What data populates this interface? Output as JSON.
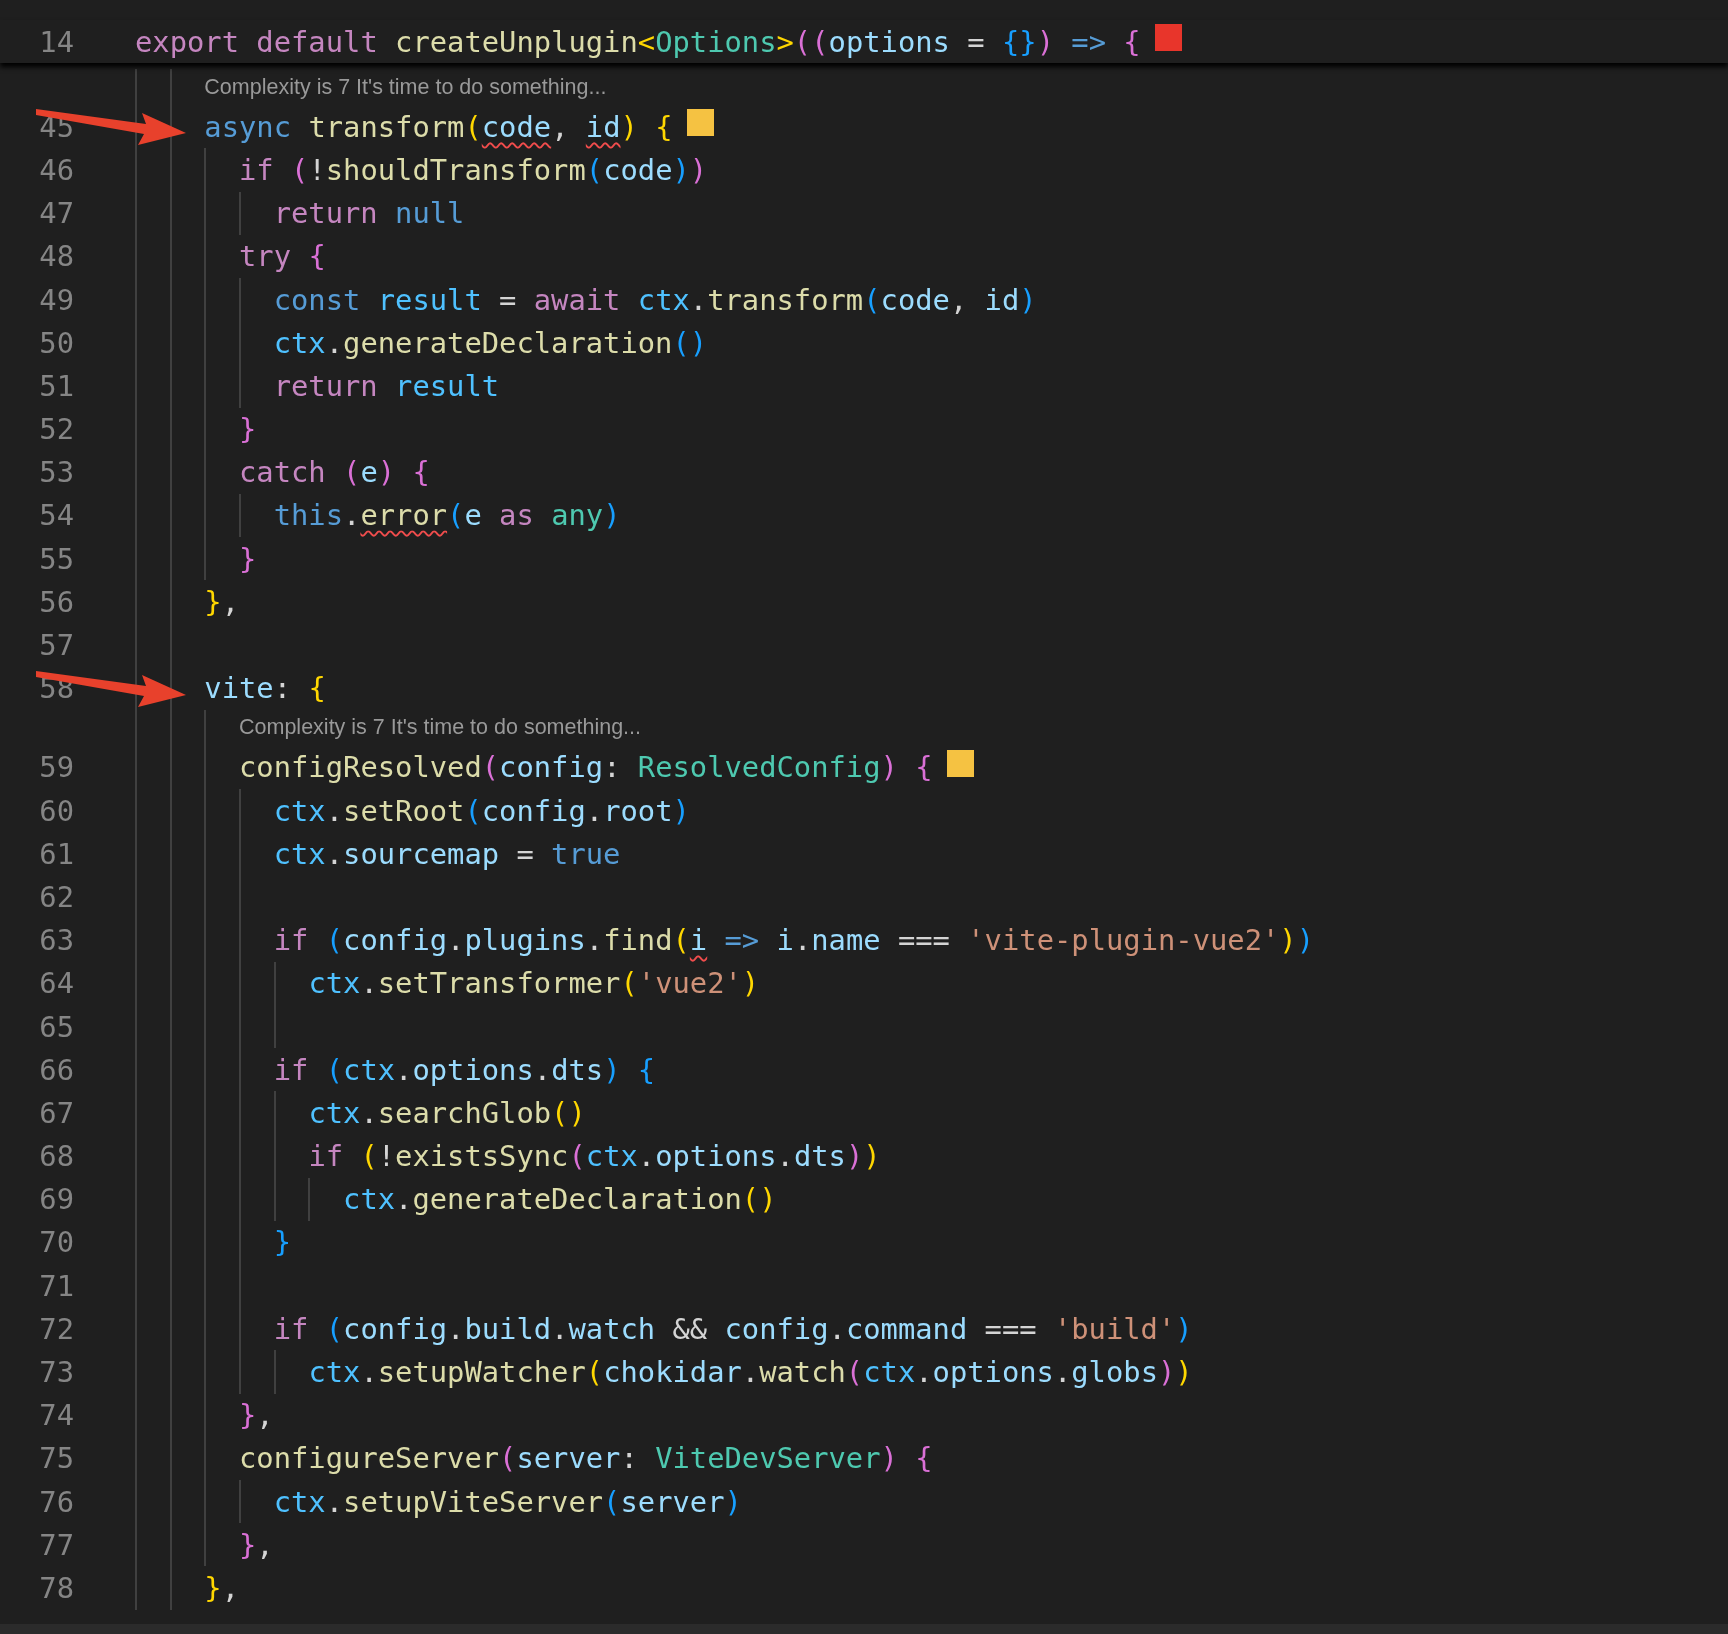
{
  "editor": {
    "sticky_line": {
      "number": "14",
      "color": "#e8352b",
      "tokens": [
        {
          "text": "export default ",
          "kind": "kw"
        },
        {
          "text": "createUnplugin",
          "kind": "fn"
        },
        {
          "text": "<",
          "kind": "b1"
        },
        {
          "text": "Options",
          "kind": "type"
        },
        {
          "text": ">",
          "kind": "b1"
        },
        {
          "text": "((",
          "kind": "b2"
        },
        {
          "text": "options",
          "kind": "var"
        },
        {
          "text": " = ",
          "kind": "op"
        },
        {
          "text": "{}",
          "kind": "b3"
        },
        {
          "text": ")",
          "kind": "b2"
        },
        {
          "text": " => ",
          "kind": "storage"
        },
        {
          "text": "{",
          "kind": "b2"
        }
      ]
    },
    "lines": [
      {
        "kind": "codelens",
        "text": "Complexity is 7 It's time to do something..."
      },
      {
        "kind": "code",
        "number": "45",
        "arrow": true,
        "color": "#f5c242",
        "tokens": [
          {
            "text": "    async ",
            "kind": "storage"
          },
          {
            "text": "transform",
            "kind": "fn"
          },
          {
            "text": "(",
            "kind": "b1"
          },
          {
            "text": "code",
            "kind": "var",
            "squiggle": true
          },
          {
            "text": ", ",
            "kind": "op"
          },
          {
            "text": "id",
            "kind": "var",
            "squiggle": true
          },
          {
            "text": ")",
            "kind": "b1"
          },
          {
            "text": " {",
            "kind": "b1"
          }
        ]
      },
      {
        "kind": "code",
        "number": "46",
        "tokens": [
          {
            "text": "      if ",
            "kind": "kw"
          },
          {
            "text": "(",
            "kind": "b2"
          },
          {
            "text": "!",
            "kind": "op"
          },
          {
            "text": "shouldTransform",
            "kind": "fn"
          },
          {
            "text": "(",
            "kind": "b3"
          },
          {
            "text": "code",
            "kind": "var"
          },
          {
            "text": ")",
            "kind": "b3"
          },
          {
            "text": ")",
            "kind": "b2"
          }
        ]
      },
      {
        "kind": "code",
        "number": "47",
        "tokens": [
          {
            "text": "        return ",
            "kind": "kw"
          },
          {
            "text": "null",
            "kind": "storage"
          }
        ]
      },
      {
        "kind": "code",
        "number": "48",
        "tokens": [
          {
            "text": "      try ",
            "kind": "kw"
          },
          {
            "text": "{",
            "kind": "b2"
          }
        ]
      },
      {
        "kind": "code",
        "number": "49",
        "tokens": [
          {
            "text": "        const ",
            "kind": "storage"
          },
          {
            "text": "result",
            "kind": "const"
          },
          {
            "text": " = ",
            "kind": "op"
          },
          {
            "text": "await ",
            "kind": "kw"
          },
          {
            "text": "ctx",
            "kind": "const"
          },
          {
            "text": ".",
            "kind": "op"
          },
          {
            "text": "transform",
            "kind": "fn"
          },
          {
            "text": "(",
            "kind": "b3"
          },
          {
            "text": "code",
            "kind": "var"
          },
          {
            "text": ", ",
            "kind": "op"
          },
          {
            "text": "id",
            "kind": "var"
          },
          {
            "text": ")",
            "kind": "b3"
          }
        ]
      },
      {
        "kind": "code",
        "number": "50",
        "tokens": [
          {
            "text": "        ctx",
            "kind": "const"
          },
          {
            "text": ".",
            "kind": "op"
          },
          {
            "text": "generateDeclaration",
            "kind": "fn"
          },
          {
            "text": "()",
            "kind": "b3"
          }
        ]
      },
      {
        "kind": "code",
        "number": "51",
        "tokens": [
          {
            "text": "        return ",
            "kind": "kw"
          },
          {
            "text": "result",
            "kind": "const"
          }
        ]
      },
      {
        "kind": "code",
        "number": "52",
        "tokens": [
          {
            "text": "      }",
            "kind": "b2"
          }
        ]
      },
      {
        "kind": "code",
        "number": "53",
        "tokens": [
          {
            "text": "      catch ",
            "kind": "kw"
          },
          {
            "text": "(",
            "kind": "b2"
          },
          {
            "text": "e",
            "kind": "var"
          },
          {
            "text": ") ",
            "kind": "b2"
          },
          {
            "text": "{",
            "kind": "b2"
          }
        ]
      },
      {
        "kind": "code",
        "number": "54",
        "tokens": [
          {
            "text": "        this",
            "kind": "storage"
          },
          {
            "text": ".",
            "kind": "op"
          },
          {
            "text": "error",
            "kind": "fn",
            "squiggle": true
          },
          {
            "text": "(",
            "kind": "b3"
          },
          {
            "text": "e ",
            "kind": "var"
          },
          {
            "text": "as ",
            "kind": "kw"
          },
          {
            "text": "any",
            "kind": "type"
          },
          {
            "text": ")",
            "kind": "b3"
          }
        ]
      },
      {
        "kind": "code",
        "number": "55",
        "tokens": [
          {
            "text": "      }",
            "kind": "b2"
          }
        ]
      },
      {
        "kind": "code",
        "number": "56",
        "tokens": [
          {
            "text": "    }",
            "kind": "b1"
          },
          {
            "text": ",",
            "kind": "op"
          }
        ]
      },
      {
        "kind": "code",
        "number": "57"
      },
      {
        "kind": "code",
        "number": "58",
        "arrow": true,
        "tokens": [
          {
            "text": "    vite",
            "kind": "var"
          },
          {
            "text": ": ",
            "kind": "op"
          },
          {
            "text": "{",
            "kind": "b1"
          }
        ]
      },
      {
        "kind": "codelens",
        "text": "Complexity is 7 It's time to do something..."
      },
      {
        "kind": "code",
        "number": "59",
        "color": "#f5c242",
        "tokens": [
          {
            "text": "      configResolved",
            "kind": "fn"
          },
          {
            "text": "(",
            "kind": "b2"
          },
          {
            "text": "config",
            "kind": "var"
          },
          {
            "text": ": ",
            "kind": "op"
          },
          {
            "text": "ResolvedConfig",
            "kind": "type"
          },
          {
            "text": ") ",
            "kind": "b2"
          },
          {
            "text": "{",
            "kind": "b2"
          }
        ]
      },
      {
        "kind": "code",
        "number": "60",
        "tokens": [
          {
            "text": "        ctx",
            "kind": "const"
          },
          {
            "text": ".",
            "kind": "op"
          },
          {
            "text": "setRoot",
            "kind": "fn"
          },
          {
            "text": "(",
            "kind": "b3"
          },
          {
            "text": "config",
            "kind": "var"
          },
          {
            "text": ".",
            "kind": "op"
          },
          {
            "text": "root",
            "kind": "var"
          },
          {
            "text": ")",
            "kind": "b3"
          }
        ]
      },
      {
        "kind": "code",
        "number": "61",
        "tokens": [
          {
            "text": "        ctx",
            "kind": "const"
          },
          {
            "text": ".",
            "kind": "op"
          },
          {
            "text": "sourcemap",
            "kind": "var"
          },
          {
            "text": " = ",
            "kind": "op"
          },
          {
            "text": "true",
            "kind": "storage"
          }
        ]
      },
      {
        "kind": "code",
        "number": "62"
      },
      {
        "kind": "code",
        "number": "63",
        "tokens": [
          {
            "text": "        if ",
            "kind": "kw"
          },
          {
            "text": "(",
            "kind": "b3"
          },
          {
            "text": "config",
            "kind": "var"
          },
          {
            "text": ".",
            "kind": "op"
          },
          {
            "text": "plugins",
            "kind": "var"
          },
          {
            "text": ".",
            "kind": "op"
          },
          {
            "text": "find",
            "kind": "fn"
          },
          {
            "text": "(",
            "kind": "b1"
          },
          {
            "text": "i",
            "kind": "var",
            "squiggle": true
          },
          {
            "text": " => ",
            "kind": "storage"
          },
          {
            "text": "i",
            "kind": "var"
          },
          {
            "text": ".",
            "kind": "op"
          },
          {
            "text": "name",
            "kind": "var"
          },
          {
            "text": " === ",
            "kind": "op"
          },
          {
            "text": "'vite-plugin-vue2'",
            "kind": "str"
          },
          {
            "text": ")",
            "kind": "b1"
          },
          {
            "text": ")",
            "kind": "b3"
          }
        ]
      },
      {
        "kind": "code",
        "number": "64",
        "tokens": [
          {
            "text": "          ctx",
            "kind": "const"
          },
          {
            "text": ".",
            "kind": "op"
          },
          {
            "text": "setTransformer",
            "kind": "fn"
          },
          {
            "text": "(",
            "kind": "b1"
          },
          {
            "text": "'vue2'",
            "kind": "str"
          },
          {
            "text": ")",
            "kind": "b1"
          }
        ]
      },
      {
        "kind": "code",
        "number": "65"
      },
      {
        "kind": "code",
        "number": "66",
        "tokens": [
          {
            "text": "        if ",
            "kind": "kw"
          },
          {
            "text": "(",
            "kind": "b3"
          },
          {
            "text": "ctx",
            "kind": "const"
          },
          {
            "text": ".",
            "kind": "op"
          },
          {
            "text": "options",
            "kind": "var"
          },
          {
            "text": ".",
            "kind": "op"
          },
          {
            "text": "dts",
            "kind": "var"
          },
          {
            "text": ") ",
            "kind": "b3"
          },
          {
            "text": "{",
            "kind": "b3"
          }
        ]
      },
      {
        "kind": "code",
        "number": "67",
        "tokens": [
          {
            "text": "          ctx",
            "kind": "const"
          },
          {
            "text": ".",
            "kind": "op"
          },
          {
            "text": "searchGlob",
            "kind": "fn"
          },
          {
            "text": "()",
            "kind": "b1"
          }
        ]
      },
      {
        "kind": "code",
        "number": "68",
        "tokens": [
          {
            "text": "          if ",
            "kind": "kw"
          },
          {
            "text": "(",
            "kind": "b1"
          },
          {
            "text": "!",
            "kind": "op"
          },
          {
            "text": "existsSync",
            "kind": "fn"
          },
          {
            "text": "(",
            "kind": "b2"
          },
          {
            "text": "ctx",
            "kind": "const"
          },
          {
            "text": ".",
            "kind": "op"
          },
          {
            "text": "options",
            "kind": "var"
          },
          {
            "text": ".",
            "kind": "op"
          },
          {
            "text": "dts",
            "kind": "var"
          },
          {
            "text": ")",
            "kind": "b2"
          },
          {
            "text": ")",
            "kind": "b1"
          }
        ]
      },
      {
        "kind": "code",
        "number": "69",
        "tokens": [
          {
            "text": "            ctx",
            "kind": "const"
          },
          {
            "text": ".",
            "kind": "op"
          },
          {
            "text": "generateDeclaration",
            "kind": "fn"
          },
          {
            "text": "()",
            "kind": "b1"
          }
        ]
      },
      {
        "kind": "code",
        "number": "70",
        "tokens": [
          {
            "text": "        }",
            "kind": "b3"
          }
        ]
      },
      {
        "kind": "code",
        "number": "71"
      },
      {
        "kind": "code",
        "number": "72",
        "tokens": [
          {
            "text": "        if ",
            "kind": "kw"
          },
          {
            "text": "(",
            "kind": "b3"
          },
          {
            "text": "config",
            "kind": "var"
          },
          {
            "text": ".",
            "kind": "op"
          },
          {
            "text": "build",
            "kind": "var"
          },
          {
            "text": ".",
            "kind": "op"
          },
          {
            "text": "watch",
            "kind": "var"
          },
          {
            "text": " && ",
            "kind": "op"
          },
          {
            "text": "config",
            "kind": "var"
          },
          {
            "text": ".",
            "kind": "op"
          },
          {
            "text": "command",
            "kind": "var"
          },
          {
            "text": " === ",
            "kind": "op"
          },
          {
            "text": "'build'",
            "kind": "str"
          },
          {
            "text": ")",
            "kind": "b3"
          }
        ]
      },
      {
        "kind": "code",
        "number": "73",
        "tokens": [
          {
            "text": "          ctx",
            "kind": "const"
          },
          {
            "text": ".",
            "kind": "op"
          },
          {
            "text": "setupWatcher",
            "kind": "fn"
          },
          {
            "text": "(",
            "kind": "b1"
          },
          {
            "text": "chokidar",
            "kind": "var"
          },
          {
            "text": ".",
            "kind": "op"
          },
          {
            "text": "watch",
            "kind": "fn"
          },
          {
            "text": "(",
            "kind": "b2"
          },
          {
            "text": "ctx",
            "kind": "const"
          },
          {
            "text": ".",
            "kind": "op"
          },
          {
            "text": "options",
            "kind": "var"
          },
          {
            "text": ".",
            "kind": "op"
          },
          {
            "text": "globs",
            "kind": "var"
          },
          {
            "text": ")",
            "kind": "b2"
          },
          {
            "text": ")",
            "kind": "b1"
          }
        ]
      },
      {
        "kind": "code",
        "number": "74",
        "tokens": [
          {
            "text": "      }",
            "kind": "b2"
          },
          {
            "text": ",",
            "kind": "op"
          }
        ]
      },
      {
        "kind": "code",
        "number": "75",
        "tokens": [
          {
            "text": "      configureServer",
            "kind": "fn"
          },
          {
            "text": "(",
            "kind": "b2"
          },
          {
            "text": "server",
            "kind": "var"
          },
          {
            "text": ": ",
            "kind": "op"
          },
          {
            "text": "ViteDevServer",
            "kind": "type"
          },
          {
            "text": ") ",
            "kind": "b2"
          },
          {
            "text": "{",
            "kind": "b2"
          }
        ]
      },
      {
        "kind": "code",
        "number": "76",
        "tokens": [
          {
            "text": "        ctx",
            "kind": "const"
          },
          {
            "text": ".",
            "kind": "op"
          },
          {
            "text": "setupViteServer",
            "kind": "fn"
          },
          {
            "text": "(",
            "kind": "b3"
          },
          {
            "text": "server",
            "kind": "var"
          },
          {
            "text": ")",
            "kind": "b3"
          }
        ]
      },
      {
        "kind": "code",
        "number": "77",
        "tokens": [
          {
            "text": "      }",
            "kind": "b2"
          },
          {
            "text": ",",
            "kind": "op"
          }
        ]
      },
      {
        "kind": "code",
        "number": "78",
        "tokens": [
          {
            "text": "    }",
            "kind": "b1"
          },
          {
            "text": ",",
            "kind": "op"
          }
        ]
      }
    ]
  }
}
